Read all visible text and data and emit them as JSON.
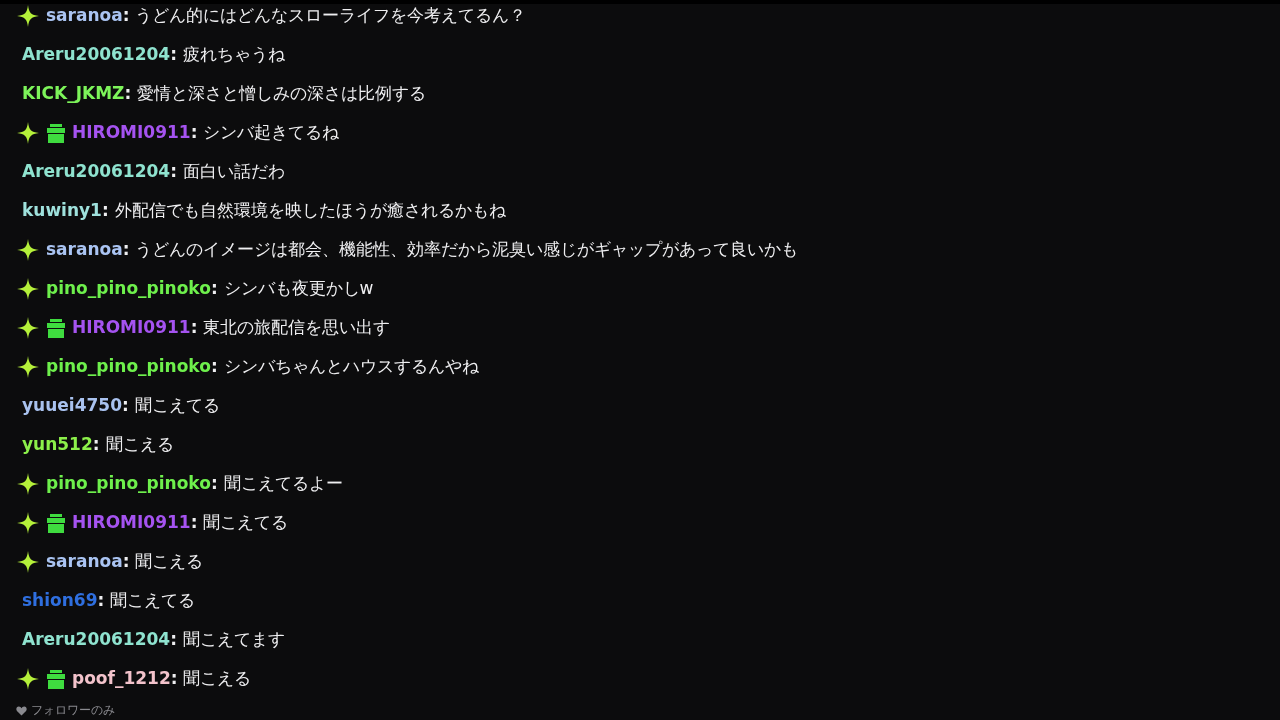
{
  "messages": [
    {
      "sparkle_badge": true,
      "gift_badge": false,
      "user": "saranoa",
      "color": "#aac4f2",
      "separator": ":",
      "text": "うどん的にはどんなスローライフを今考えてるん？"
    },
    {
      "sparkle_badge": false,
      "gift_badge": false,
      "user": "Areru20061204",
      "color": "#8fe3cf",
      "separator": ":",
      "text": "疲れちゃうね"
    },
    {
      "sparkle_badge": false,
      "gift_badge": false,
      "user": "KICK_JKMZ",
      "color": "#7df45a",
      "separator": ":",
      "text": "愛情と深さと憎しみの深さは比例する"
    },
    {
      "sparkle_badge": true,
      "gift_badge": true,
      "user": "HIROMI0911",
      "color": "#a553f0",
      "separator": ":",
      "text": "シンバ起きてるね"
    },
    {
      "sparkle_badge": false,
      "gift_badge": false,
      "user": "Areru20061204",
      "color": "#8fe3cf",
      "separator": ":",
      "text": "面白い話だわ"
    },
    {
      "sparkle_badge": false,
      "gift_badge": false,
      "user": "kuwiny1",
      "color": "#9fe1dc",
      "separator": ":",
      "text": "外配信でも自然環境を映したほうが癒されるかもね"
    },
    {
      "sparkle_badge": true,
      "gift_badge": false,
      "user": "saranoa",
      "color": "#aac4f2",
      "separator": ":",
      "text": "うどんのイメージは都会、機能性、効率だから泥臭い感じがギャップがあって良いかも"
    },
    {
      "sparkle_badge": true,
      "gift_badge": false,
      "user": "pino_pino_pinoko",
      "color": "#6ef04c",
      "separator": ":",
      "text": "シンバも夜更かしw"
    },
    {
      "sparkle_badge": true,
      "gift_badge": true,
      "user": "HIROMI0911",
      "color": "#a553f0",
      "separator": ":",
      "text": "東北の旅配信を思い出す"
    },
    {
      "sparkle_badge": true,
      "gift_badge": false,
      "user": "pino_pino_pinoko",
      "color": "#6ef04c",
      "separator": ":",
      "text": "シンバちゃんとハウスするんやね"
    },
    {
      "sparkle_badge": false,
      "gift_badge": false,
      "user": "yuuei4750",
      "color": "#a9c2ef",
      "separator": ":",
      "text": "聞こえてる"
    },
    {
      "sparkle_badge": false,
      "gift_badge": false,
      "user": "yun512",
      "color": "#8cf04a",
      "separator": ":",
      "text": "聞こえる"
    },
    {
      "sparkle_badge": true,
      "gift_badge": false,
      "user": "pino_pino_pinoko",
      "color": "#6ef04c",
      "separator": ":",
      "text": "聞こえてるよー"
    },
    {
      "sparkle_badge": true,
      "gift_badge": true,
      "user": "HIROMI0911",
      "color": "#a553f0",
      "separator": ":",
      "text": "聞こえてる"
    },
    {
      "sparkle_badge": true,
      "gift_badge": false,
      "user": "saranoa",
      "color": "#aac4f2",
      "separator": ":",
      "text": "聞こえる"
    },
    {
      "sparkle_badge": false,
      "gift_badge": false,
      "user": "shion69",
      "color": "#2f6fdf",
      "separator": ":",
      "text": "聞こえてる"
    },
    {
      "sparkle_badge": false,
      "gift_badge": false,
      "user": "Areru20061204",
      "color": "#8fe3cf",
      "separator": ":",
      "text": "聞こえてます"
    },
    {
      "sparkle_badge": true,
      "gift_badge": true,
      "user": "poof_1212",
      "color": "#f3c3cb",
      "separator": ":",
      "text": "聞こえる"
    }
  ],
  "chat_mode": {
    "label": "フォロワーのみ"
  }
}
